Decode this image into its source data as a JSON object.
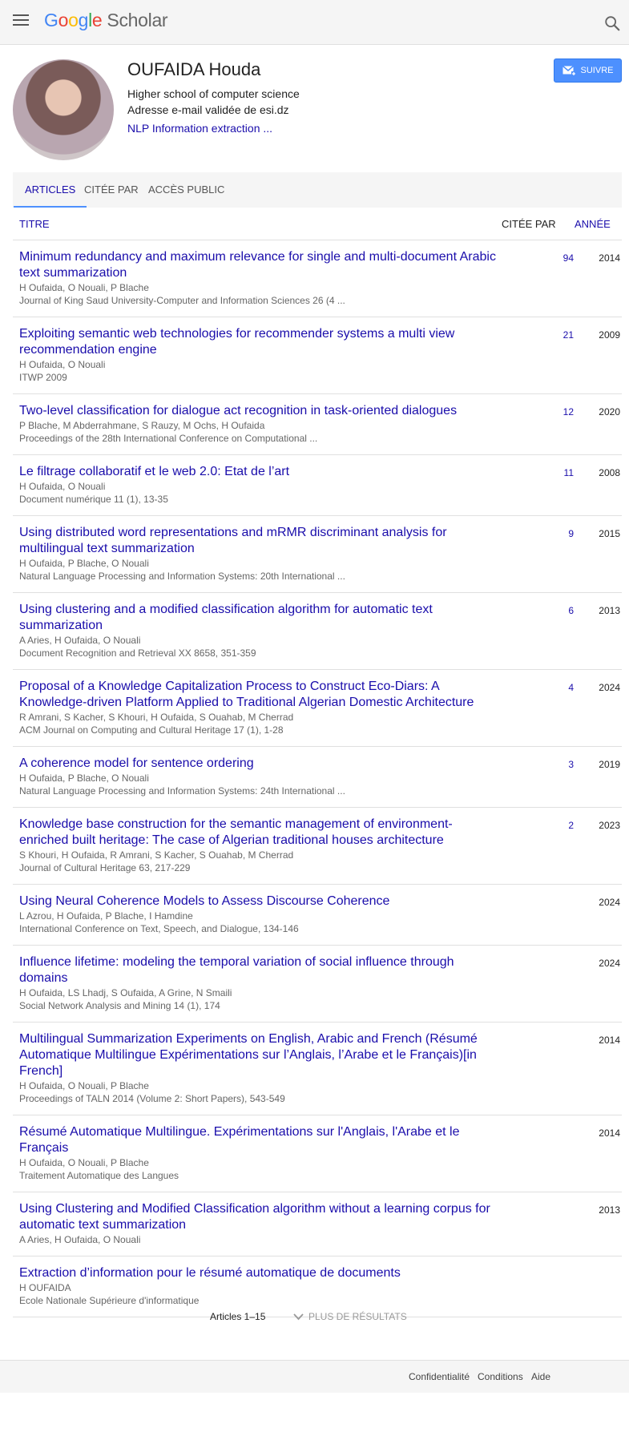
{
  "header": {
    "logo_google": "Google",
    "logo_scholar": "Scholar"
  },
  "profile": {
    "name": "OUFAIDA Houda",
    "affiliation": "Higher school of computer science",
    "email": "Adresse e-mail validée de esi.dz",
    "interests": "NLP Information extraction ...",
    "follow_label": "SUIVRE"
  },
  "tabs": [
    "ARTICLES",
    "CITÉE PAR",
    "ACCÈS PUBLIC"
  ],
  "columns": {
    "title": "TITRE",
    "cited": "CITÉE PAR",
    "year": "ANNÉE"
  },
  "articles": [
    {
      "title": "Minimum redundancy and maximum relevance for single and multi-document Arabic text summarization",
      "authors": "H Oufaida, O Nouali, P Blache",
      "venue": "Journal of King Saud University-Computer and Information Sciences 26 (4 ...",
      "cited": "94",
      "year": "2014"
    },
    {
      "title": "Exploiting semantic web technologies for recommender systems a multi view recommendation engine",
      "authors": "H Oufaida, O Nouali",
      "venue": "ITWP 2009",
      "cited": "21",
      "year": "2009"
    },
    {
      "title": "Two-level classification for dialogue act recognition in task-oriented dialogues",
      "authors": "P Blache, M Abderrahmane, S Rauzy, M Ochs, H Oufaida",
      "venue": "Proceedings of the 28th International Conference on Computational ...",
      "cited": "12",
      "year": "2020"
    },
    {
      "title": "Le filtrage collaboratif et le web 2.0: Etat de l’art",
      "authors": "H Oufaida, O Nouali",
      "venue": "Document numérique 11 (1), 13-35",
      "cited": "11",
      "year": "2008"
    },
    {
      "title": "Using distributed word representations and mRMR discriminant analysis for multilingual text summarization",
      "authors": "H Oufaida, P Blache, O Nouali",
      "venue": "Natural Language Processing and Information Systems: 20th International ...",
      "cited": "9",
      "year": "2015"
    },
    {
      "title": "Using clustering and a modified classification algorithm for automatic text summarization",
      "authors": "A Aries, H Oufaida, O Nouali",
      "venue": "Document Recognition and Retrieval XX 8658, 351-359",
      "cited": "6",
      "year": "2013"
    },
    {
      "title": "Proposal of a Knowledge Capitalization Process to Construct Eco-Diars: A Knowledge-driven Platform Applied to Traditional Algerian Domestic Architecture",
      "authors": "R Amrani, S Kacher, S Khouri, H Oufaida, S Ouahab, M Cherrad",
      "venue": "ACM Journal on Computing and Cultural Heritage 17 (1), 1-28",
      "cited": "4",
      "year": "2024"
    },
    {
      "title": "A coherence model for sentence ordering",
      "authors": "H Oufaida, P Blache, O Nouali",
      "venue": "Natural Language Processing and Information Systems: 24th International ...",
      "cited": "3",
      "year": "2019"
    },
    {
      "title": "Knowledge base construction for the semantic management of environment-enriched built heritage: The case of Algerian traditional houses architecture",
      "authors": "S Khouri, H Oufaida, R Amrani, S Kacher, S Ouahab, M Cherrad",
      "venue": "Journal of Cultural Heritage 63, 217-229",
      "cited": "2",
      "year": "2023"
    },
    {
      "title": "Using Neural Coherence Models to Assess Discourse Coherence",
      "authors": "L Azrou, H Oufaida, P Blache, I Hamdine",
      "venue": "International Conference on Text, Speech, and Dialogue, 134-146",
      "cited": "",
      "year": "2024"
    },
    {
      "title": "Influence lifetime: modeling the temporal variation of social influence through domains",
      "authors": "H Oufaida, LS Lhadj, S Oufaida, A Grine, N Smaili",
      "venue": "Social Network Analysis and Mining 14 (1), 174",
      "cited": "",
      "year": "2024"
    },
    {
      "title": "Multilingual Summarization Experiments on English, Arabic and French (Résumé Automatique Multilingue Expérimentations sur l’Anglais, l’Arabe et le Français)[in French]",
      "authors": "H Oufaida, O Nouali, P Blache",
      "venue": "Proceedings of TALN 2014 (Volume 2: Short Papers), 543-549",
      "cited": "",
      "year": "2014"
    },
    {
      "title": "Résumé Automatique Multilingue. Expérimentations sur l'Anglais, l'Arabe et le Français",
      "authors": "H Oufaida, O Nouali, P Blache",
      "venue": "Traitement Automatique des Langues",
      "cited": "",
      "year": "2014"
    },
    {
      "title": "Using Clustering and Modified Classification algorithm without a learning corpus for automatic text summarization",
      "authors": "A Aries, H Oufaida, O Nouali",
      "venue": "",
      "cited": "",
      "year": "2013"
    },
    {
      "title": "Extraction d’information pour le résumé automatique de documents",
      "authors": "H OUFAIDA",
      "venue": "Ecole Nationale Supérieure d'informatique",
      "cited": "",
      "year": ""
    }
  ],
  "pager": {
    "count": "Articles 1–15",
    "more": "PLUS DE RÉSULTATS"
  },
  "footer": {
    "privacy": "Confidentialité",
    "terms": "Conditions",
    "help": "Aide"
  },
  "colors": {
    "link": "#1a0dab",
    "accent": "#4d90fe",
    "muted": "#666666",
    "bar": "#f5f5f5"
  },
  "icons": {
    "menu": "menu-icon",
    "search": "search-icon",
    "follow": "email-plus-icon",
    "more": "chevron-down-icon"
  }
}
